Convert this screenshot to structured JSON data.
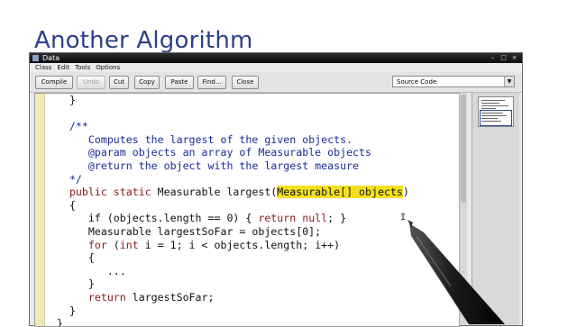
{
  "slide_title": "Another Algorithm",
  "window": {
    "title": "Data",
    "controls": [
      "–",
      "□",
      "×"
    ]
  },
  "menu": [
    "Class",
    "Edit",
    "Tools",
    "Options"
  ],
  "toolbar": {
    "compile": "Compile",
    "undo": "Undo",
    "cut": "Cut",
    "copy": "Copy",
    "paste": "Paste",
    "find": "Find...",
    "close": "Close",
    "view_select": "Source Code"
  },
  "code": {
    "l1": "   }",
    "l3": "   /**",
    "l4": "      Computes the largest of the given objects.",
    "l5": "      @param objects an array of Measurable objects",
    "l6": "      @return the object with the largest measure",
    "l7": "   */",
    "l8_kw": "   public static",
    "l8_a": " Measurable largest(",
    "l8_hl": "Measurable[] objects",
    "l8_b": ")",
    "l9": "   {",
    "l10_a": "      if (objects.length == 0) { ",
    "l10_kw1": "return",
    "l10_sp": " ",
    "l10_kw2": "null",
    "l10_b": "; }",
    "l11": "      Measurable largestSoFar = objects[0];",
    "l12_kw1": "      for",
    "l12_a": " (",
    "l12_kw2": "int",
    "l12_b": " i = 1; i < objects.length; i++)",
    "l13": "      {",
    "l14": "         ...",
    "l15": "      }",
    "l16_kw": "      return",
    "l16_a": " largestSoFar;",
    "l17": "   }",
    "l18": " }"
  },
  "colors": {
    "title": "#2e3f8a",
    "keyword": "#8b1a1a",
    "comment": "#1a2a9a",
    "highlight": "#f6e01c",
    "gutter": "#f0e9b8"
  }
}
